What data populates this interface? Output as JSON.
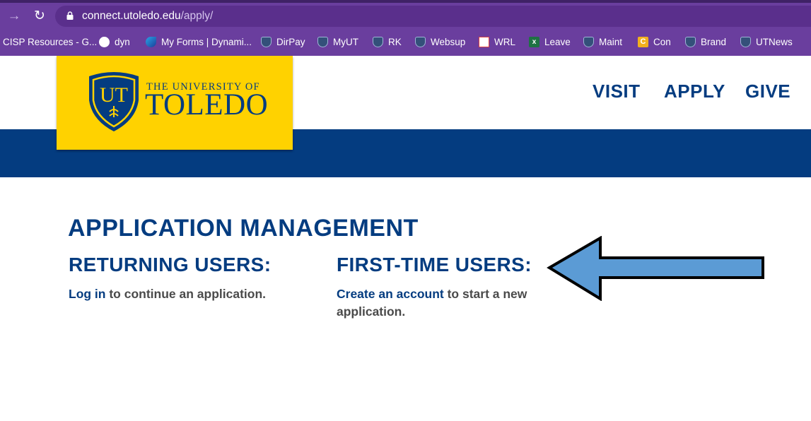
{
  "browser": {
    "url_host": "connect.utoledo.edu",
    "url_path": "/apply/",
    "bookmarks": [
      {
        "label": "CISP Resources - G...",
        "icon": "none"
      },
      {
        "label": "dyn",
        "icon": "globe-icon"
      },
      {
        "label": "My Forms | Dynami...",
        "icon": "dynamics-icon"
      },
      {
        "label": "DirPay",
        "icon": "ut-shield-icon"
      },
      {
        "label": "MyUT",
        "icon": "ut-shield-icon"
      },
      {
        "label": "RK",
        "icon": "ut-shield-icon"
      },
      {
        "label": "Websup",
        "icon": "ut-shield-icon"
      },
      {
        "label": "WRL",
        "icon": "gmail-icon"
      },
      {
        "label": "Leave",
        "icon": "excel-icon"
      },
      {
        "label": "Maint",
        "icon": "ut-shield-icon"
      },
      {
        "label": "Con",
        "icon": "con-icon"
      },
      {
        "label": "Brand",
        "icon": "ut-shield-icon"
      },
      {
        "label": "UTNews",
        "icon": "ut-shield-icon"
      }
    ]
  },
  "site": {
    "logo_line1": "THE UNIVERSITY OF",
    "logo_line2": "TOLEDO",
    "logo_monogram": "UT",
    "nav": {
      "visit": "VISIT",
      "apply": "APPLY",
      "give": "GIVE"
    }
  },
  "main": {
    "title": "APPLICATION MANAGEMENT",
    "returning": {
      "heading": "RETURNING USERS:",
      "link": "Log in",
      "text": " to continue an application."
    },
    "first_time": {
      "heading": "FIRST-TIME USERS:",
      "link": "Create an account",
      "text": " to start a new application."
    }
  },
  "colors": {
    "browser_frame": "#6a3e9e",
    "brand_blue": "#043c80",
    "brand_gold": "#ffd200",
    "arrow_fill": "#5b9bd5"
  }
}
